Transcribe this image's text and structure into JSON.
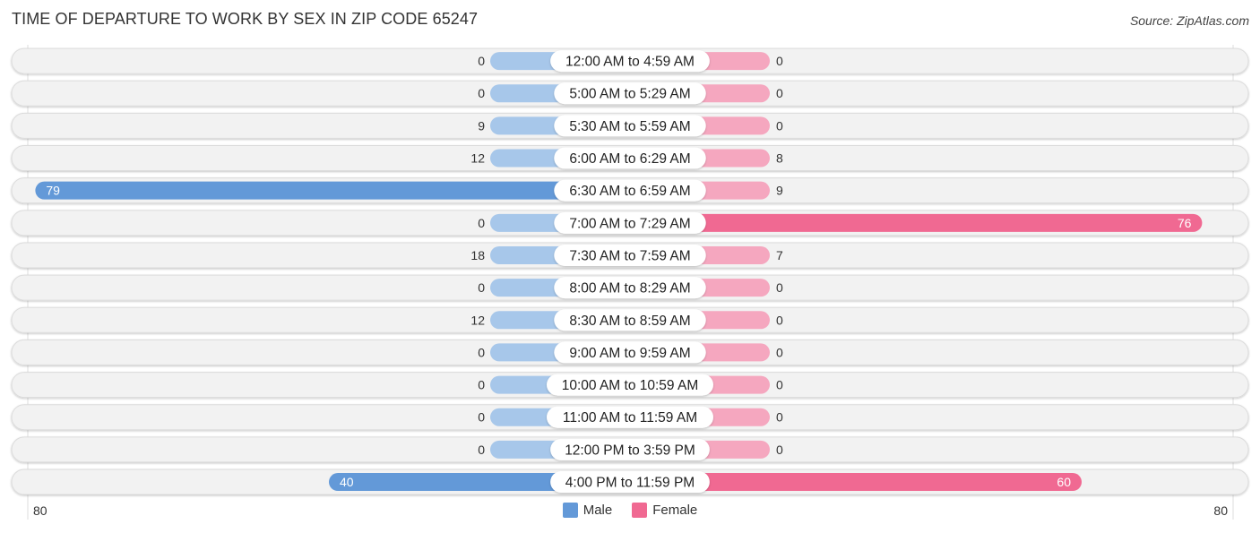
{
  "chart_data": {
    "type": "bar",
    "orientation": "diverging-horizontal",
    "title": "TIME OF DEPARTURE TO WORK BY SEX IN ZIP CODE 65247",
    "source": "Source: ZipAtlas.com",
    "categories": [
      "12:00 AM to 4:59 AM",
      "5:00 AM to 5:29 AM",
      "5:30 AM to 5:59 AM",
      "6:00 AM to 6:29 AM",
      "6:30 AM to 6:59 AM",
      "7:00 AM to 7:29 AM",
      "7:30 AM to 7:59 AM",
      "8:00 AM to 8:29 AM",
      "8:30 AM to 8:59 AM",
      "9:00 AM to 9:59 AM",
      "10:00 AM to 10:59 AM",
      "11:00 AM to 11:59 AM",
      "12:00 PM to 3:59 PM",
      "4:00 PM to 11:59 PM"
    ],
    "series": [
      {
        "name": "Male",
        "side": "left",
        "values": [
          0,
          0,
          9,
          12,
          79,
          0,
          18,
          0,
          12,
          0,
          0,
          0,
          0,
          40
        ]
      },
      {
        "name": "Female",
        "side": "right",
        "values": [
          0,
          0,
          0,
          8,
          9,
          76,
          7,
          0,
          0,
          0,
          0,
          0,
          0,
          60
        ]
      }
    ],
    "xlim": [
      -80,
      80
    ],
    "axis_tick_labels": {
      "left": "80",
      "right": "80"
    },
    "legend": {
      "position": "bottom-center",
      "entries": [
        "Male",
        "Female"
      ]
    },
    "colors": {
      "male_light": "#a7c7ea",
      "male_strong": "#6399d8",
      "female_light": "#f5a7bf",
      "female_strong": "#f06992",
      "row_background": "#f2f2f2",
      "label_pill": "#ffffff"
    },
    "grid": false
  }
}
